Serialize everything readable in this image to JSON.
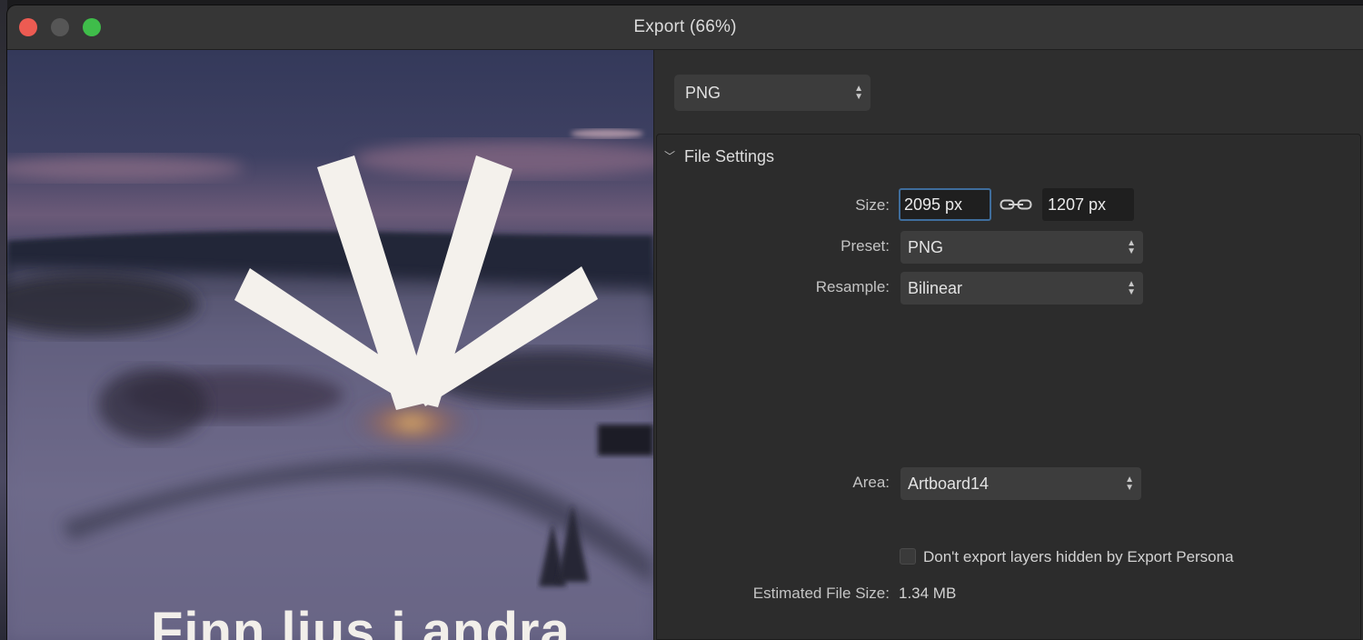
{
  "window": {
    "title": "Export (66%)"
  },
  "preview": {
    "overlay_text": "Finn ljus i andra"
  },
  "format": {
    "selected": "PNG"
  },
  "file_settings": {
    "section_title": "File Settings",
    "size_label": "Size:",
    "width_value": "2095 px",
    "height_value": "1207 px",
    "preset_label": "Preset:",
    "preset_value": "PNG",
    "resample_label": "Resample:",
    "resample_value": "Bilinear",
    "area_label": "Area:",
    "area_value": "Artboard14",
    "hidden_layers_label": "Don't export layers hidden by Export Persona",
    "hidden_layers_checked": false,
    "estimated_label": "Estimated File Size:",
    "estimated_value": "1.34 MB"
  },
  "icons": {
    "close": "traffic-light-close",
    "minimize": "traffic-light-minimize",
    "maximize": "traffic-light-maximize",
    "link": "link-chain-icon",
    "disclosure": "chevron-down-icon",
    "stepper": "up-down-arrows-icon"
  },
  "colors": {
    "close": "#ed5b52",
    "maximize": "#3fbd4a",
    "focus_ring": "#3f6d9c"
  }
}
